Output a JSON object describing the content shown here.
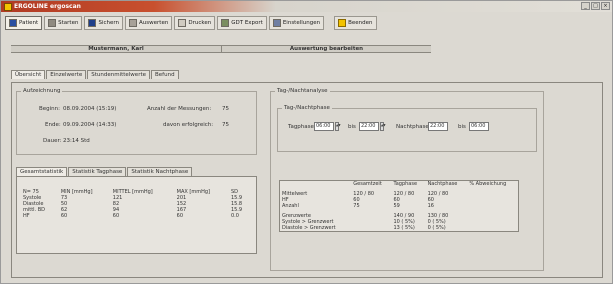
{
  "title": "ERGOLINE  ergoscan",
  "window_controls": {
    "min": "_",
    "max": "□",
    "close": "×"
  },
  "toolbar": {
    "patient": "Patient",
    "start": "Starten",
    "save": "Sichern",
    "evaluate": "Auswerten",
    "print": "Drucken",
    "export": "GDT Export",
    "settings": "Einstellungen",
    "exit": "Beenden"
  },
  "infobar": {
    "patient_name": "Mustermann, Karl",
    "status": "Auswertung bearbeiten"
  },
  "main_tabs": [
    "Übersicht",
    "Einzelwerte",
    "Stundenmittelwerte",
    "Befund"
  ],
  "recording": {
    "title": "Aufzeichnung",
    "begin_label": "Beginn:",
    "begin_value": "08.09.2004 (15:19)",
    "end_label": "Ende:",
    "end_value": "09.09.2004 (14:33)",
    "duration_label": "Dauer:",
    "duration_value": "23:14 Std",
    "measurements_label": "Anzahl der Messungen:",
    "measurements_value": "75",
    "successful_label": "davon erfolgreich:",
    "successful_value": "75"
  },
  "stats_tabs": [
    "Gesamtstatistik",
    "Statistik Tagphase",
    "Statistik Nachtphase"
  ],
  "stats_table": {
    "headers": [
      "",
      "MIN [mmHg]",
      "MITTEL [mmHg]",
      "MAX [mmHg]",
      "SD"
    ],
    "count_label": "N= 75",
    "rows": [
      [
        "Systole",
        "73",
        "121",
        "201",
        "15.9"
      ],
      [
        "Diastole",
        "50",
        "82",
        "152",
        "15.8"
      ],
      [
        "mittl. BD",
        "62",
        "94",
        "167",
        "15.9"
      ],
      [
        "HF",
        "60",
        "60",
        "60",
        "0.0"
      ]
    ]
  },
  "day_night": {
    "title": "Tag-/Nachtanalyse",
    "subtitle": "Tag-/Nachtphase",
    "day_label": "Tagphase",
    "day_from": "06:00",
    "to_label": "bis",
    "day_to": "22:00",
    "night_label": "Nachtphase",
    "night_from": "22:00",
    "night_to": "06:00"
  },
  "analysis_table": {
    "headers": [
      "",
      "Gesamtzeit",
      "Tagphase",
      "Nachtphase",
      "% Abweichung"
    ],
    "mittelwert_label": "Mittelwert",
    "hf_label": "HF",
    "mittel": [
      "120 / 80",
      "120 / 80",
      "120 / 80",
      ""
    ],
    "hf": [
      "60",
      "60",
      "60",
      ""
    ],
    "anzahl_label": "Anzahl",
    "anzahl": [
      "75",
      "59",
      "16",
      ""
    ],
    "grenz_label": "Grenzwerte",
    "sys_label": "Systole > Grenzwert",
    "dia_label": "Diastole > Grenzwert",
    "grenz": [
      "",
      "140 / 90",
      "130 / 80",
      ""
    ],
    "sys": [
      "",
      "10 ( 5%)",
      "0 ( 5%)",
      ""
    ],
    "dia": [
      "",
      "13 ( 5%)",
      "0 ( 5%)",
      ""
    ]
  }
}
